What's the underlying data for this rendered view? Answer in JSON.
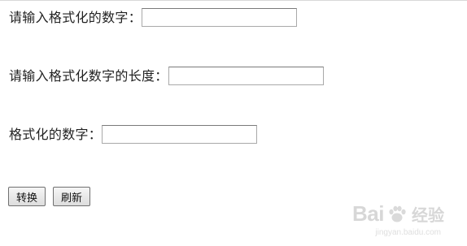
{
  "form": {
    "number_label": "请输入格式化的数字：",
    "number_value": "",
    "length_label": "请输入格式化数字的长度：",
    "length_value": "",
    "result_label": "格式化的数字：",
    "result_value": ""
  },
  "buttons": {
    "convert": "转换",
    "refresh": "刷新"
  },
  "watermark": {
    "brand": "Bai",
    "brand_tail": "百",
    "product": "经验",
    "url": "jingyan.baidu.com"
  }
}
